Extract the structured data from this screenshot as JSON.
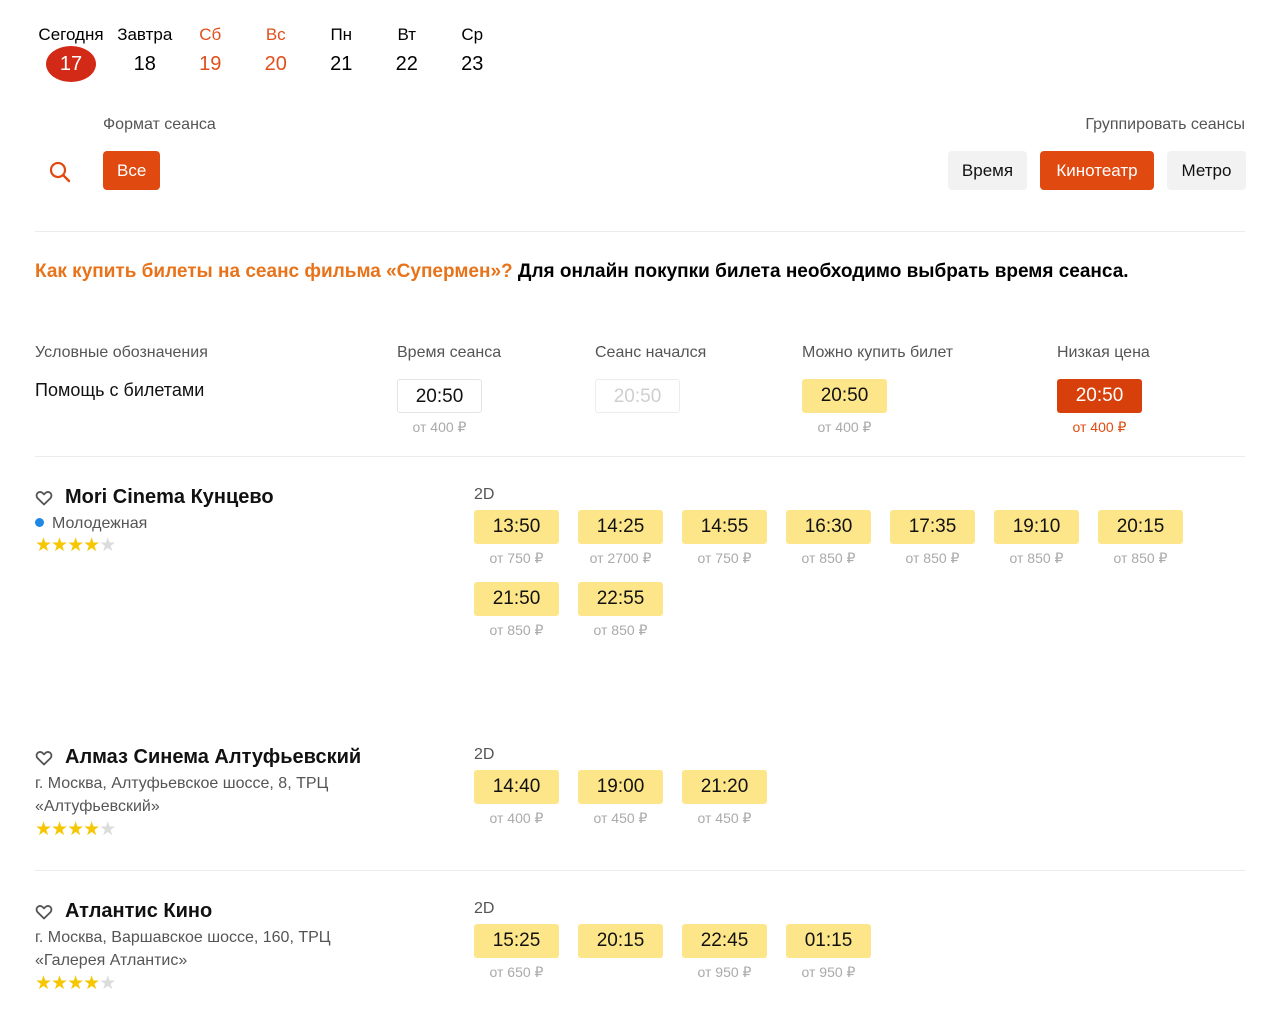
{
  "days": [
    {
      "name": "Сегодня",
      "num": "17",
      "selected": true,
      "weekend": false
    },
    {
      "name": "Завтра",
      "num": "18",
      "selected": false,
      "weekend": false
    },
    {
      "name": "Сб",
      "num": "19",
      "selected": false,
      "weekend": true
    },
    {
      "name": "Вс",
      "num": "20",
      "selected": false,
      "weekend": true
    },
    {
      "name": "Пн",
      "num": "21",
      "selected": false,
      "weekend": false
    },
    {
      "name": "Вт",
      "num": "22",
      "selected": false,
      "weekend": false
    },
    {
      "name": "Ср",
      "num": "23",
      "selected": false,
      "weekend": false
    }
  ],
  "filters": {
    "format_label": "Формат сеанса",
    "all_label": "Все",
    "group_label": "Группировать сеансы",
    "group_time": "Время",
    "group_cinema": "Кинотеатр",
    "group_metro": "Метро"
  },
  "howto": {
    "question": "Как купить билеты на сеанс фильма «Супермен»?",
    "answer": " Для онлайн покупки билета необходимо выбрать время сеанса."
  },
  "legend": {
    "title": "Условные обозначения",
    "help": "Помощь с билетами",
    "items": [
      {
        "head": "Время сеанса",
        "time": "20:50",
        "price": "от 400 ₽",
        "kind": "white"
      },
      {
        "head": "Сеанс начался",
        "time": "20:50",
        "price": "",
        "kind": "started"
      },
      {
        "head": "Можно купить билет",
        "time": "20:50",
        "price": "от 400 ₽",
        "kind": "yellow"
      },
      {
        "head": "Низкая цена",
        "time": "20:50",
        "price": "от 400 ₽",
        "kind": "red"
      }
    ]
  },
  "cinemas": [
    {
      "name": "Mori Cinema Кунцево",
      "metro": "Молодежная",
      "address": "",
      "rating": 4,
      "format": "2D",
      "sessions": [
        {
          "time": "13:50",
          "price": "от 750 ₽"
        },
        {
          "time": "14:25",
          "price": "от 2700 ₽"
        },
        {
          "time": "14:55",
          "price": "от 750 ₽"
        },
        {
          "time": "16:30",
          "price": "от 850 ₽"
        },
        {
          "time": "17:35",
          "price": "от 850 ₽"
        },
        {
          "time": "19:10",
          "price": "от 850 ₽"
        },
        {
          "time": "20:15",
          "price": "от 850 ₽"
        },
        {
          "time": "21:50",
          "price": "от 850 ₽"
        },
        {
          "time": "22:55",
          "price": "от 850 ₽"
        }
      ]
    },
    {
      "name": "Алмаз Синема Алтуфьевский",
      "metro": "",
      "address": "г. Москва, Алтуфьевское шоссе, 8, ТРЦ «Алтуфьевский»",
      "rating": 4,
      "format": "2D",
      "sessions": [
        {
          "time": "14:40",
          "price": "от 400 ₽"
        },
        {
          "time": "19:00",
          "price": "от 450 ₽"
        },
        {
          "time": "21:20",
          "price": "от 450 ₽"
        }
      ]
    },
    {
      "name": "Атлантис Кино",
      "metro": "",
      "address": "г. Москва, Варшавское шоссе, 160, ТРЦ «Галерея Атлантис»",
      "rating": 4,
      "format": "2D",
      "sessions": [
        {
          "time": "15:25",
          "price": "от 650 ₽"
        },
        {
          "time": "20:15",
          "price": ""
        },
        {
          "time": "22:45",
          "price": "от 950 ₽"
        },
        {
          "time": "01:15",
          "price": "от 950 ₽"
        }
      ]
    }
  ],
  "colors": {
    "accent": "#e04a10",
    "selected_day": "#d22a16",
    "question": "#e8731a",
    "session_bg": "#fde68a",
    "metro_dot": "#1e88e5",
    "star": "#f6c700"
  },
  "icons": {
    "search": "search-icon",
    "favorite": "heart-icon",
    "rating": "star-icon"
  }
}
